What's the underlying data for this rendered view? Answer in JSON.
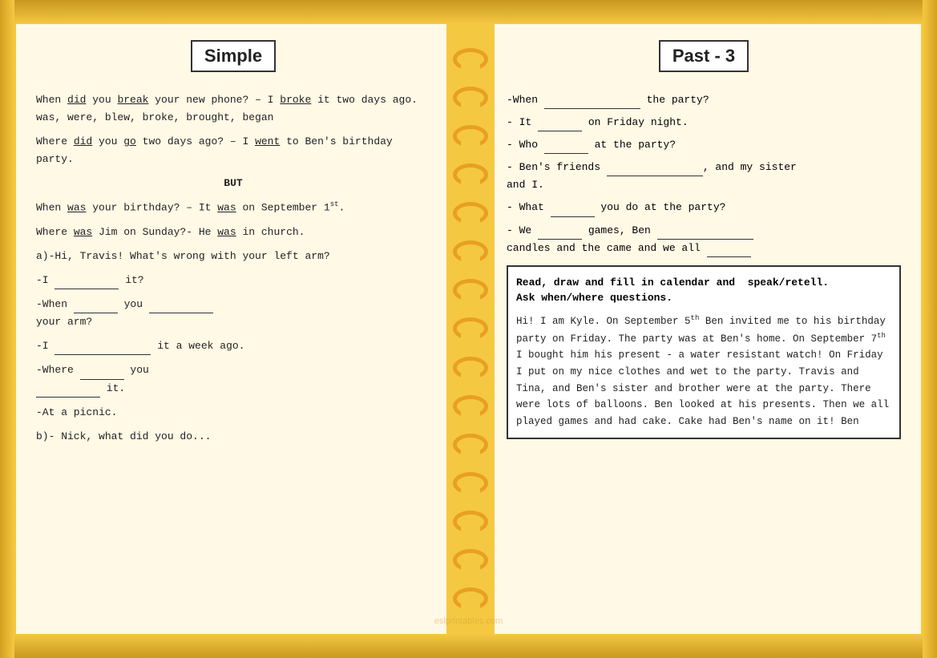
{
  "left": {
    "title": "Simple",
    "paragraphs": [
      {
        "id": "p1",
        "html": "When <u>did</u> you <u>break</u> your new phone? – I <u>broke</u> it two days ago. was, were, blew, broke, brought, began"
      },
      {
        "id": "p2",
        "html": "Where <u>did</u> you <u>go</u> two days ago? – I <u>went</u> to Ben's birthday party."
      },
      {
        "id": "p3_but",
        "html": "BUT"
      },
      {
        "id": "p4",
        "html": "When <u>was</u> your birthday? – It <u>was</u> on September 1<sup>st</sup>."
      },
      {
        "id": "p5",
        "html": "Where <u>was</u> Jim on Sunday?- He <u>was</u> in church."
      },
      {
        "id": "p6",
        "html": "a)-Hi, Travis! What's wrong with your left arm?"
      },
      {
        "id": "p7",
        "html": "-I __________ it?"
      },
      {
        "id": "p8",
        "html": "-When _________ you _____________ your arm?"
      },
      {
        "id": "p9",
        "html": "-I _______________ it a week ago."
      },
      {
        "id": "p10",
        "html": "-Where __________ you _____________ it."
      },
      {
        "id": "p11",
        "html": "-At a picnic."
      },
      {
        "id": "p12",
        "html": "b)- Nick, what did you do..."
      }
    ]
  },
  "right": {
    "title": "Past - 3",
    "fill_lines": [
      "-When ______________ the party?",
      "- It __________ on Friday night.",
      "- Who __________ at the party?",
      "- Ben's friends _____________, and my sister and I.",
      "- What __________ you do at the party?",
      "- We __________ games, Ben _________________ candles and the came and we all __________"
    ],
    "read_draw": {
      "title": "Read, draw and fill in calendar and  speak/retell. Ask when/where questions.",
      "content": "Hi! I am Kyle. On September 5th Ben invited me to his birthday party on Friday. The party was at Ben's home. On September 7th I bought him his present - a water resistant watch! On Friday I put on my nice clothes and wet to the party. Travis and Tina, and Ben's sister and brother were at the party. There were lots of balloons. Ben looked at his presents. Then we all played games and had cake. Cake had Ben's name on it! Ben"
    }
  },
  "watermark": "eslprintables.com"
}
